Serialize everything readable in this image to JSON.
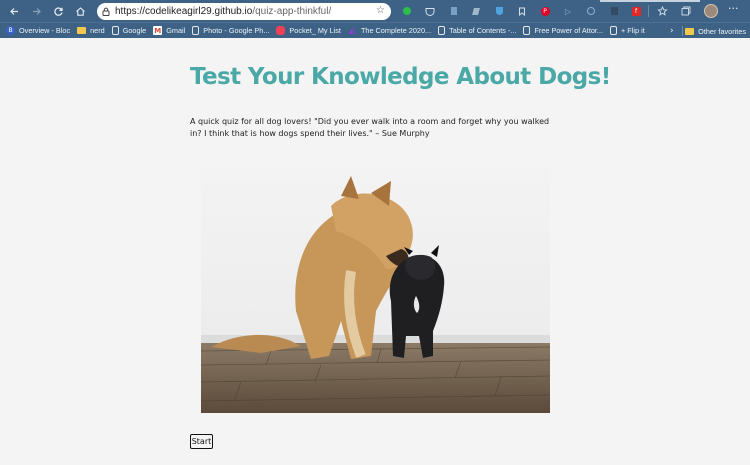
{
  "browser": {
    "url_domain": "https://codelikeagirl29.github.io",
    "url_path": "/quiz-app-thinkful/",
    "bookmarks": [
      {
        "label": "Overview - Bloc",
        "icon": "bloc-icon",
        "color": "#3a63c8"
      },
      {
        "label": "nerd",
        "icon": "folder-icon",
        "color": "#f2c94c"
      },
      {
        "label": "Google",
        "icon": "page-icon",
        "color": "#e6e6e6"
      },
      {
        "label": "Gmail",
        "icon": "gmail-icon",
        "color": "#d44638"
      },
      {
        "label": "Photo - Google Ph...",
        "icon": "page-icon",
        "color": "#e6e6e6"
      },
      {
        "label": "Pocket_ My List",
        "icon": "pocket-icon",
        "color": "#ef4056"
      },
      {
        "label": "The Complete 2020...",
        "icon": "udemy-icon",
        "color": "#a435f0"
      },
      {
        "label": "Table of Contents -...",
        "icon": "page-icon",
        "color": "#e6e6e6"
      },
      {
        "label": "Free Power of Attor...",
        "icon": "page-icon",
        "color": "#e6e6e6"
      },
      {
        "label": "+ Flip it",
        "icon": "page-icon",
        "color": "#e6e6e6"
      }
    ],
    "other_favorites": "Other favorites"
  },
  "page": {
    "title": "Test Your Knowledge About Dogs!",
    "intro": "A quick quiz for all dog lovers! \"Did you ever walk into a room and forget why you walked in? I think that is how dogs spend their lives.\" – Sue Murphy",
    "start_label": "Start",
    "title_color": "#4aa8a6"
  }
}
